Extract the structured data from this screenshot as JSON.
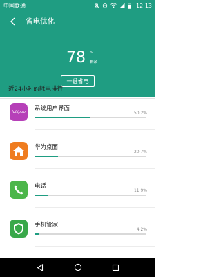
{
  "status": {
    "carrier": "中国联通",
    "time": "12:13",
    "icons": [
      "mute-icon",
      "alarm-icon",
      "wifi-icon",
      "signal-icon",
      "battery-icon"
    ]
  },
  "header": {
    "title": "省电优化",
    "battery_percent": "78",
    "percent_sign": "%",
    "remaining_label": "剩余",
    "one_key_button": "一键省电",
    "bg_color": "#1f9d82"
  },
  "ranking": {
    "title": "近24小时的耗电排行",
    "items": [
      {
        "name": "系统用户界面",
        "percent_text": "50.2%",
        "percent": 50.2,
        "icon": "lollipop-icon",
        "icon_text": "lollipop"
      },
      {
        "name": "华为桌面",
        "percent_text": "20.7%",
        "percent": 20.7,
        "icon": "home-icon"
      },
      {
        "name": "电话",
        "percent_text": "11.9%",
        "percent": 11.9,
        "icon": "phone-icon"
      },
      {
        "name": "手机管家",
        "percent_text": "4.2%",
        "percent": 4.2,
        "icon": "shield-icon"
      }
    ]
  },
  "navbar": {
    "icons": [
      "back-triangle-icon",
      "home-circle-icon",
      "recents-square-icon"
    ]
  }
}
